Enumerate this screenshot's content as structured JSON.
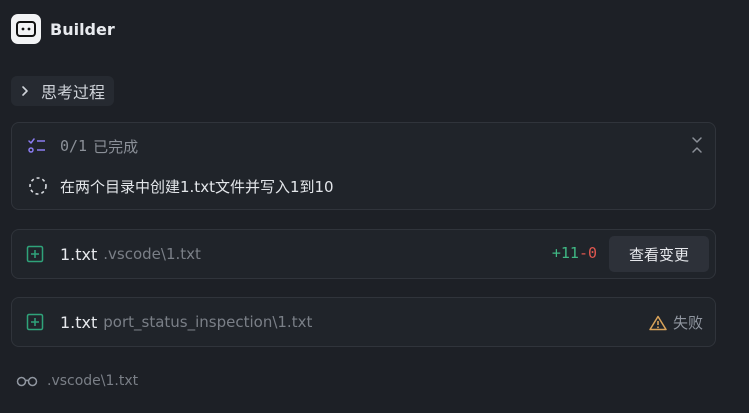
{
  "app": {
    "title": "Builder"
  },
  "thinking": {
    "label": "思考过程"
  },
  "tasks": {
    "progress": "0/1",
    "status_label": "已完成",
    "items": [
      {
        "label": "在两个目录中创建1.txt文件并写入1到10",
        "state": "in-progress"
      }
    ]
  },
  "files": [
    {
      "name": "1.txt",
      "path": ".vscode\\1.txt",
      "added": "+11",
      "removed": "-0",
      "action_label": "查看变更"
    },
    {
      "name": "1.txt",
      "path": "port_status_inspection\\1.txt",
      "status_label": "失败",
      "status_icon": "warning-icon"
    }
  ],
  "footer": {
    "path": ".vscode\\1.txt",
    "icon": "glasses-icon"
  },
  "colors": {
    "background": "#1d2026",
    "card": "#20242a",
    "added": "#3fb884",
    "removed": "#e0574f",
    "file_icon": "#2fa37a",
    "warning": "#d9a35a",
    "todo_icon": "#8b7cf0"
  }
}
